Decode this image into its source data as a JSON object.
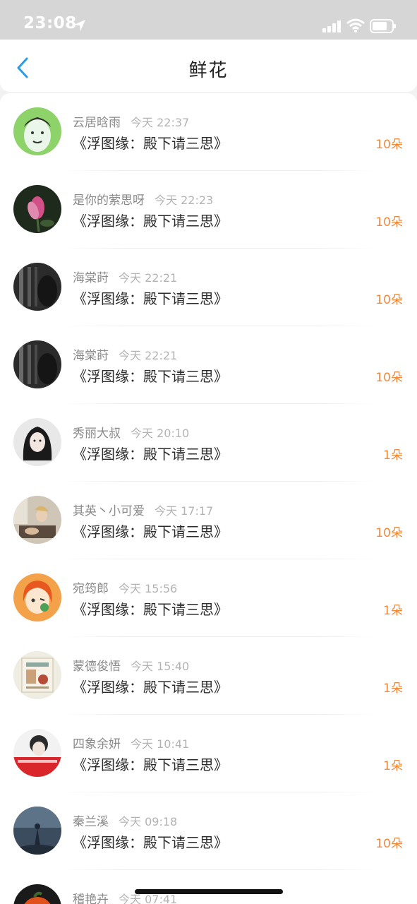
{
  "status_bar": {
    "time": "23:08"
  },
  "header": {
    "title": "鲜花"
  },
  "rows": [
    {
      "username": "云居晗雨",
      "time": "今天 22:37",
      "book": "《浮图缘：殿下请三思》",
      "count": "10朵",
      "avatar": "cartoon-face"
    },
    {
      "username": "是你的萦思呀",
      "time": "今天 22:23",
      "book": "《浮图缘：殿下请三思》",
      "count": "10朵",
      "avatar": "magnolia-flower"
    },
    {
      "username": "海棠莳",
      "time": "今天 22:21",
      "book": "《浮图缘：殿下请三思》",
      "count": "10朵",
      "avatar": "dark-window"
    },
    {
      "username": "海棠莳",
      "time": "今天 22:21",
      "book": "《浮图缘：殿下请三思》",
      "count": "10朵",
      "avatar": "dark-window"
    },
    {
      "username": "秀丽大叔",
      "time": "今天 20:10",
      "book": "《浮图缘：殿下请三思》",
      "count": "1朵",
      "avatar": "girl-portrait"
    },
    {
      "username": "其英丶小可爱",
      "time": "今天 17:17",
      "book": "《浮图缘：殿下请三思》",
      "count": "10朵",
      "avatar": "room-photo"
    },
    {
      "username": "宛筠郎",
      "time": "今天 15:56",
      "book": "《浮图缘：殿下请三思》",
      "count": "1朵",
      "avatar": "cartoon-girl"
    },
    {
      "username": "蒙德俊悟",
      "time": "今天 15:40",
      "book": "《浮图缘：殿下请三思》",
      "count": "1朵",
      "avatar": "poster"
    },
    {
      "username": "四象余妍",
      "time": "今天 10:41",
      "book": "《浮图缘：殿下请三思》",
      "count": "1朵",
      "avatar": "portrait-red"
    },
    {
      "username": "秦兰溪",
      "time": "今天 09:18",
      "book": "《浮图缘：殿下请三思》",
      "count": "10朵",
      "avatar": "night-sky"
    },
    {
      "username": "稽艳卉",
      "time": "今天 07:41",
      "book": "",
      "count": "",
      "avatar": "orange-fruit"
    }
  ]
}
